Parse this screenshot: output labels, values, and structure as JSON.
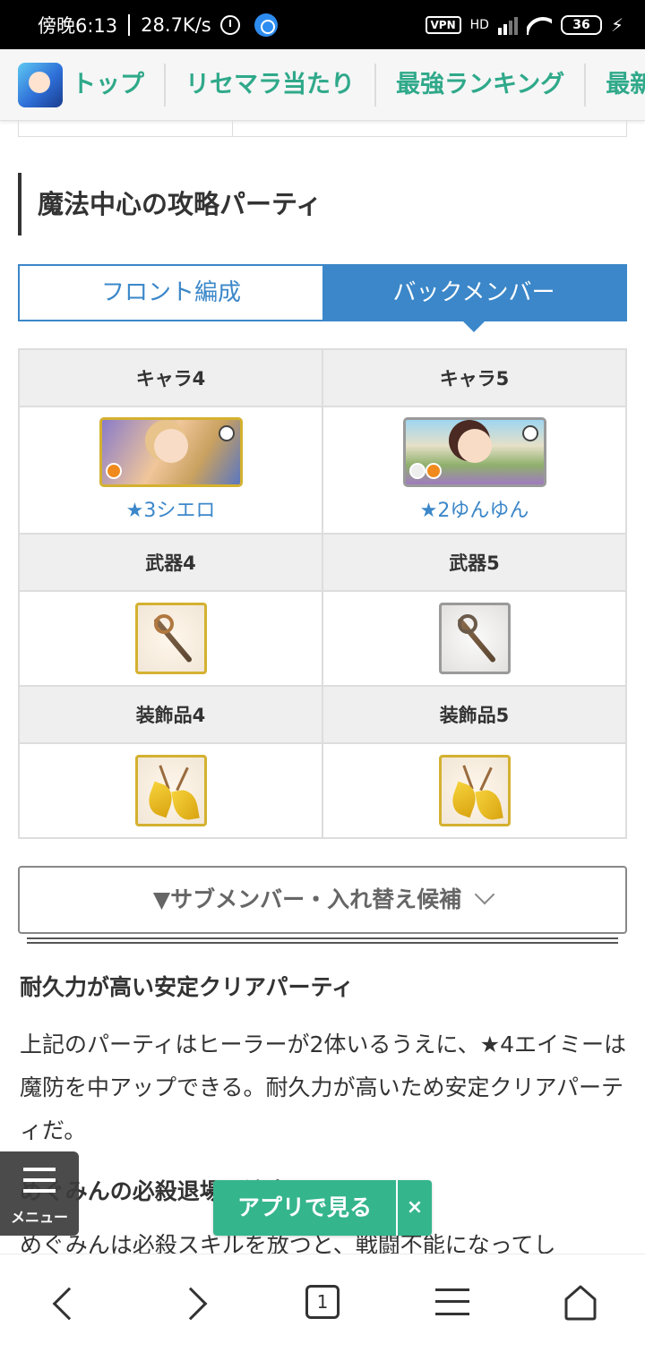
{
  "status": {
    "time": "傍晚6:13",
    "speed": "28.7K/s",
    "vpn": "VPN",
    "network": "HD",
    "battery": "36"
  },
  "nav": {
    "items": [
      "トップ",
      "リセマラ当たり",
      "最強ランキング",
      "最新"
    ]
  },
  "section": {
    "title": "魔法中心の攻略パーティ"
  },
  "tabs": {
    "front": "フロント編成",
    "back": "バックメンバー"
  },
  "party": {
    "headers": {
      "chara4": "キャラ4",
      "chara5": "キャラ5",
      "weapon4": "武器4",
      "weapon5": "武器5",
      "acc4": "装飾品4",
      "acc5": "装飾品5"
    },
    "chara4_name": "★3シエロ",
    "chara5_name": "★2ゆんゆん"
  },
  "accordion": {
    "label": "▼サブメンバー・入れ替え候補"
  },
  "article": {
    "heading1": "耐久力が高い安定クリアパーティ",
    "paragraph1": "上記のパーティはヒーラーが2体いるうえに、★4エイミーは魔防を中アップできる。耐久力が高いため安定クリアパーティだ。",
    "heading2": "めぐみんの必殺退場に注意",
    "paragraph2": "めぐみんは必殺スキルを放つと、戦闘不能になってし"
  },
  "floating": {
    "menu_label": "メニュー",
    "app_label": "アプリで見る",
    "close": "×"
  },
  "browser": {
    "tab_count": "1"
  }
}
